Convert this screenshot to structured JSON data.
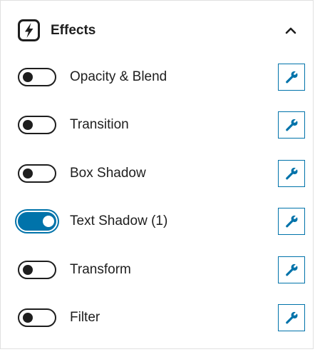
{
  "panel": {
    "title": "Effects",
    "icon": "lightning-bolt-icon",
    "collapse_icon": "chevron-up-icon"
  },
  "effects": [
    {
      "label": "Opacity & Blend",
      "enabled": false,
      "action_icon": "wrench-icon"
    },
    {
      "label": "Transition",
      "enabled": false,
      "action_icon": "wrench-icon"
    },
    {
      "label": "Box Shadow",
      "enabled": false,
      "action_icon": "wrench-icon"
    },
    {
      "label": "Text Shadow (1)",
      "enabled": true,
      "action_icon": "wrench-icon"
    },
    {
      "label": "Transform",
      "enabled": false,
      "action_icon": "wrench-icon"
    },
    {
      "label": "Filter",
      "enabled": false,
      "action_icon": "wrench-icon"
    }
  ],
  "colors": {
    "accent": "#0073aa",
    "text": "#1e1e1e",
    "border": "#e0e0e0"
  }
}
